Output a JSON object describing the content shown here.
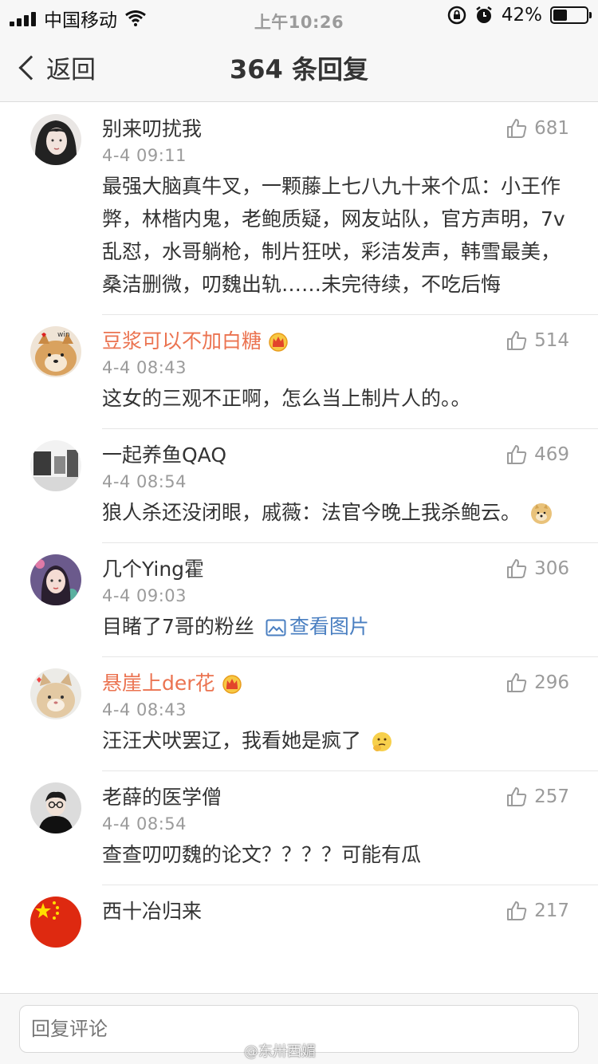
{
  "status_bar": {
    "carrier": "中国移动",
    "time": "上午10:26",
    "battery_percent": "42%",
    "battery_level": 0.42
  },
  "nav": {
    "back_label": "返回",
    "title": "364 条回复"
  },
  "comments": [
    {
      "username": "别来叨扰我",
      "time": "4-4 09:11",
      "likes": "681",
      "content": "最强大脑真牛叉，一颗藤上七八九十来个瓜：小王作弊，林楷内鬼，老鲍质疑，网友站队，官方声明，7v乱怼，水哥躺枪，制片狂吠，彩洁发声，韩雪最美，桑洁删微，叨魏出轨……未完待续，不吃后悔"
    },
    {
      "username": "豆浆可以不加白糖",
      "time": "4-4 08:43",
      "likes": "514",
      "content": "这女的三观不正啊，怎么当上制片人的。。"
    },
    {
      "username": "一起养鱼QAQ",
      "time": "4-4 08:54",
      "likes": "469",
      "content": "狼人杀还没闭眼，戚薇：法官今晚上我杀鲍云。"
    },
    {
      "username": "几个Ying霍",
      "time": "4-4 09:03",
      "likes": "306",
      "content": "目睹了7哥的粉丝",
      "link_label": "查看图片"
    },
    {
      "username": "悬崖上der花",
      "time": "4-4 08:43",
      "likes": "296",
      "content": "汪汪犬吠罢辽，我看她是疯了"
    },
    {
      "username": "老薛的医学僧",
      "time": "4-4 08:54",
      "likes": "257",
      "content": "查查叨叨魏的论文？？？？可能有瓜"
    },
    {
      "username": "西十冶归来",
      "likes": "217"
    }
  ],
  "avatar_wm": "win",
  "reply": {
    "placeholder": "回复评论"
  },
  "watermark": "@东卅西媚",
  "colors": {
    "vip_name": "#eb7350",
    "link": "#4a7fc1",
    "meta": "#9b9b9b"
  },
  "icons": [
    "like-icon",
    "crown-icon",
    "picture-icon",
    "chevron-left-icon",
    "wifi-icon",
    "alarm-icon",
    "lock-rotation-icon"
  ]
}
